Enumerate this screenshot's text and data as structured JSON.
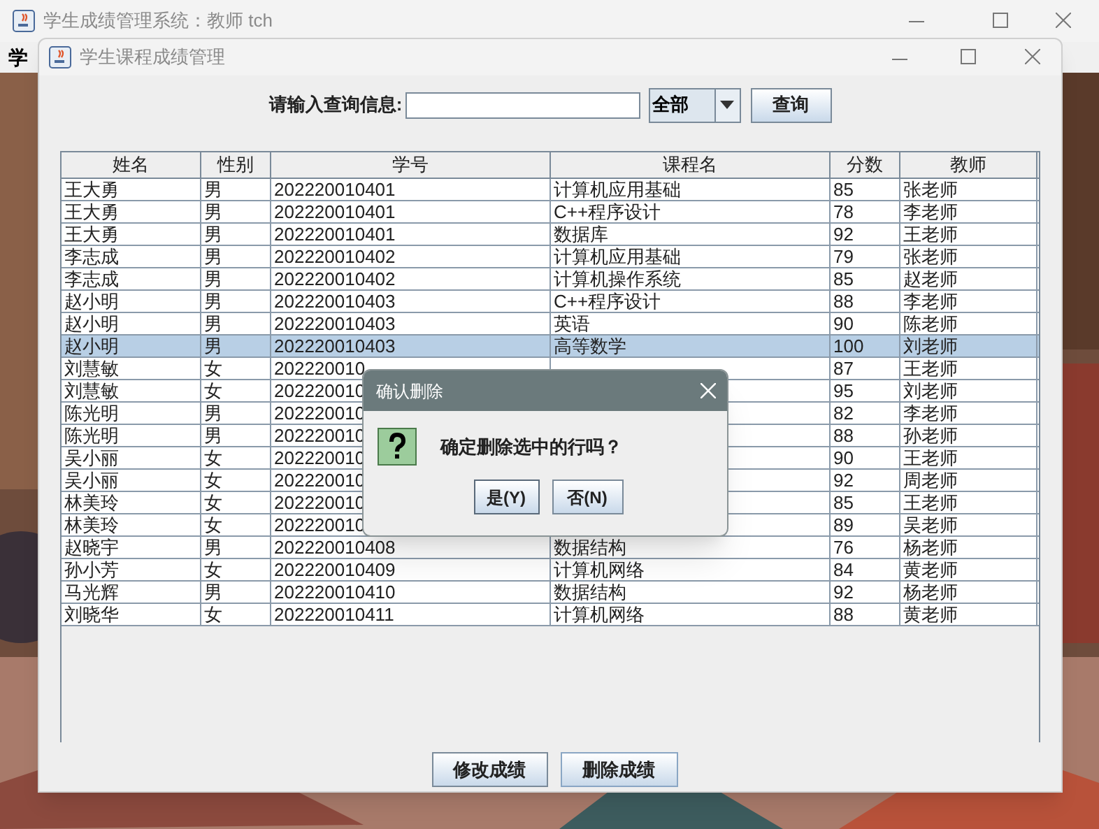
{
  "main_window": {
    "title": "学生成绩管理系统：教师 tch",
    "menu": [
      "学"
    ]
  },
  "grade_window": {
    "title": "学生课程成绩管理",
    "search_label": "请输入查询信息:",
    "filter": "全部",
    "search_button": "查询"
  },
  "table": {
    "columns": [
      "姓名",
      "性别",
      "学号",
      "课程名",
      "分数",
      "教师"
    ],
    "rows": [
      {
        "name": "王大勇",
        "gender": "男",
        "student_id": "202220010401",
        "course": "计算机应用基础",
        "score": "85",
        "teacher": "张老师",
        "selected": false
      },
      {
        "name": "王大勇",
        "gender": "男",
        "student_id": "202220010401",
        "course": "C++程序设计",
        "score": "78",
        "teacher": "李老师",
        "selected": false
      },
      {
        "name": "王大勇",
        "gender": "男",
        "student_id": "202220010401",
        "course": "数据库",
        "score": "92",
        "teacher": "王老师",
        "selected": false
      },
      {
        "name": "李志成",
        "gender": "男",
        "student_id": "202220010402",
        "course": "计算机应用基础",
        "score": "79",
        "teacher": "张老师",
        "selected": false
      },
      {
        "name": "李志成",
        "gender": "男",
        "student_id": "202220010402",
        "course": "计算机操作系统",
        "score": "85",
        "teacher": "赵老师",
        "selected": false
      },
      {
        "name": "赵小明",
        "gender": "男",
        "student_id": "202220010403",
        "course": "C++程序设计",
        "score": "88",
        "teacher": "李老师",
        "selected": false
      },
      {
        "name": "赵小明",
        "gender": "男",
        "student_id": "202220010403",
        "course": "英语",
        "score": "90",
        "teacher": "陈老师",
        "selected": false
      },
      {
        "name": "赵小明",
        "gender": "男",
        "student_id": "202220010403",
        "course": "高等数学",
        "score": "100",
        "teacher": "刘老师",
        "selected": true
      },
      {
        "name": "刘慧敏",
        "gender": "女",
        "student_id": "202220010",
        "score": "87",
        "teacher": "王老师",
        "selected": false
      },
      {
        "name": "刘慧敏",
        "gender": "女",
        "student_id": "202220010",
        "score": "95",
        "teacher": "刘老师",
        "selected": false
      },
      {
        "name": "陈光明",
        "gender": "男",
        "student_id": "202220010",
        "score": "82",
        "teacher": "李老师",
        "selected": false
      },
      {
        "name": "陈光明",
        "gender": "男",
        "student_id": "202220010",
        "score": "88",
        "teacher": "孙老师",
        "selected": false
      },
      {
        "name": "吴小丽",
        "gender": "女",
        "student_id": "202220010",
        "score": "90",
        "teacher": "王老师",
        "selected": false
      },
      {
        "name": "吴小丽",
        "gender": "女",
        "student_id": "202220010",
        "score": "92",
        "teacher": "周老师",
        "selected": false
      },
      {
        "name": "林美玲",
        "gender": "女",
        "student_id": "202220010",
        "score": "85",
        "teacher": "王老师",
        "selected": false
      },
      {
        "name": "林美玲",
        "gender": "女",
        "student_id": "202220010",
        "score": "89",
        "teacher": "吴老师",
        "selected": false
      },
      {
        "name": "赵晓宇",
        "gender": "男",
        "student_id": "202220010408",
        "course": "数据结构",
        "score": "76",
        "teacher": "杨老师",
        "selected": false
      },
      {
        "name": "孙小芳",
        "gender": "女",
        "student_id": "202220010409",
        "course": "计算机网络",
        "score": "84",
        "teacher": "黄老师",
        "selected": false
      },
      {
        "name": "马光辉",
        "gender": "男",
        "student_id": "202220010410",
        "course": "数据结构",
        "score": "92",
        "teacher": "杨老师",
        "selected": false
      },
      {
        "name": "刘晓华",
        "gender": "女",
        "student_id": "202220010411",
        "course": "计算机网络",
        "score": "88",
        "teacher": "黄老师",
        "selected": false
      }
    ]
  },
  "buttons": [
    "修改成绩",
    "删除成绩"
  ],
  "confirm_dialog": {
    "title": "确认删除",
    "message": "确定删除选中的行吗？",
    "buttons": [
      "是(Y)",
      "否(N)"
    ]
  }
}
